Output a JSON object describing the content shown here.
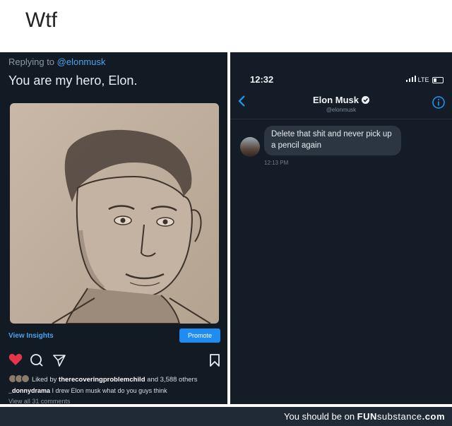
{
  "caption": "Wtf",
  "left": {
    "replying_prefix": "Replying to ",
    "replying_handle": "@elonmusk",
    "tweet_text": "You are my hero, Elon.",
    "view_insights": "View Insights",
    "promote": "Promote",
    "liked_prefix": "Liked by ",
    "liked_user": "therecoveringproblemchild",
    "liked_suffix": " and 3,588 others",
    "caption_user": "_donnydrama",
    "caption_text": " I drew Elon musk what do you guys think",
    "view_comments": "View all 31 comments",
    "icons": [
      "heart-icon",
      "comment-icon",
      "send-icon",
      "bookmark-icon"
    ],
    "colors": {
      "heart": "#e8344a",
      "link": "#4aa3ef",
      "promote": "#1e8cf0"
    }
  },
  "right": {
    "time": "12:32",
    "network": "LTE",
    "contact_name": "Elon Musk",
    "contact_handle": "@elonmusk",
    "message": "Delete that shit and never pick up a pencil again",
    "message_time": "12:13 PM"
  },
  "footer": {
    "prefix": "You should be on ",
    "brand_a": "FUN",
    "brand_b": "substance",
    "brand_c": ".com"
  }
}
